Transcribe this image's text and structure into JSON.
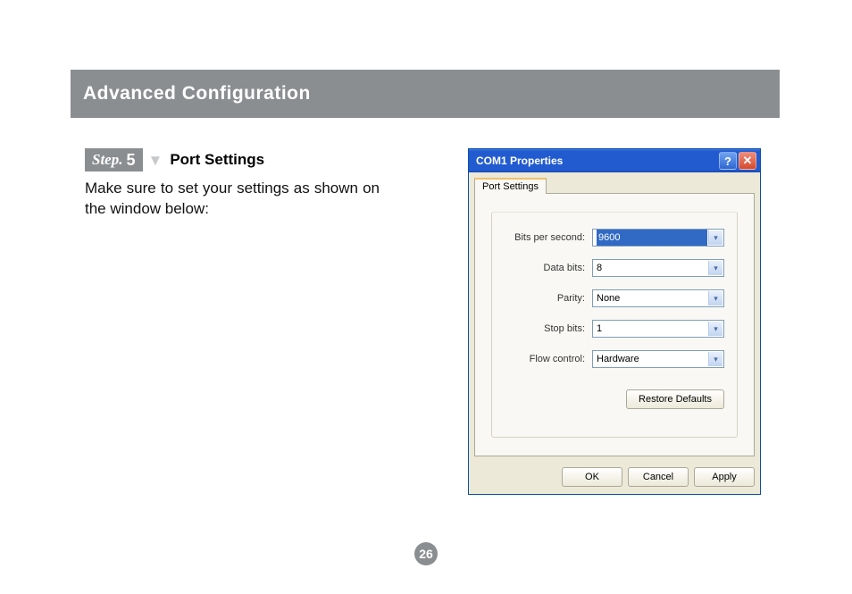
{
  "header": {
    "title": "Advanced Configuration"
  },
  "step": {
    "badge_prefix": "Step.",
    "badge_number": "5",
    "title": "Port Settings"
  },
  "instruction": "Make sure to set your settings as shown on the window below:",
  "dialog": {
    "title": "COM1 Properties",
    "tab": "Port Settings",
    "fields": {
      "bits_per_second": {
        "label": "Bits per second:",
        "value": "9600"
      },
      "data_bits": {
        "label": "Data bits:",
        "value": "8"
      },
      "parity": {
        "label": "Parity:",
        "value": "None"
      },
      "stop_bits": {
        "label": "Stop bits:",
        "value": "1"
      },
      "flow_control": {
        "label": "Flow control:",
        "value": "Hardware"
      }
    },
    "buttons": {
      "restore": "Restore Defaults",
      "ok": "OK",
      "cancel": "Cancel",
      "apply": "Apply"
    }
  },
  "page_number": "26"
}
